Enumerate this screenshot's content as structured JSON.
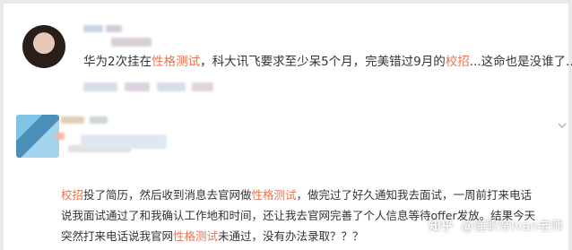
{
  "post1": {
    "segments": [
      {
        "text": "华为2次挂在",
        "highlight": false
      },
      {
        "text": "性格测试",
        "highlight": true
      },
      {
        "text": "，科大讯飞要求至少呆5个月，完美错过9月的",
        "highlight": false
      },
      {
        "text": "校招",
        "highlight": true
      },
      {
        "text": "...这命也是没谁了...",
        "highlight": false
      }
    ]
  },
  "post2": {
    "lines": [
      [
        {
          "text": "校招",
          "highlight": true
        },
        {
          "text": "投了简历，然后收到消息去官网做",
          "highlight": false
        },
        {
          "text": "性格测试",
          "highlight": true
        },
        {
          "text": "，做完过了好久通知我去面试，一周前打来电话",
          "highlight": false
        }
      ],
      [
        {
          "text": "说我面试通过了和我确认工作地和时间，还让我去官网完善了个人信息等待offer发放。结果今天",
          "highlight": false
        }
      ],
      [
        {
          "text": "突然打来电话说我官网",
          "highlight": false
        },
        {
          "text": "性格测试",
          "highlight": true
        },
        {
          "text": "未通过，没有办法录取？？？",
          "highlight": false
        }
      ]
    ]
  },
  "watermark": {
    "logo": "知乎",
    "author": "@懂职帝Ivan老师"
  },
  "colors": {
    "highlight": "#eb7350",
    "text": "#333333"
  }
}
